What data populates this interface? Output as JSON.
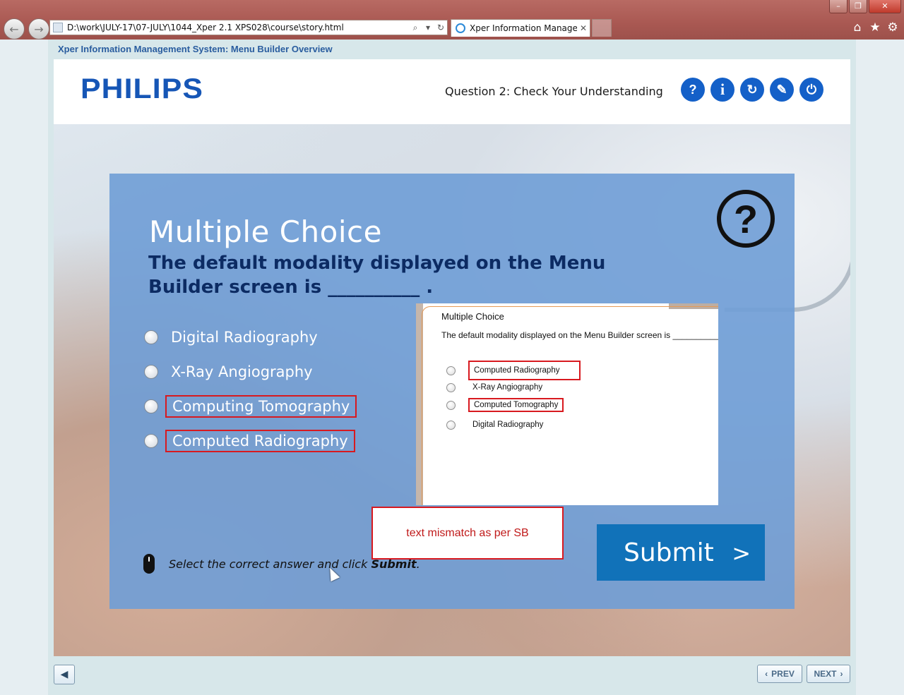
{
  "browser": {
    "address": "D:\\work\\JULY-17\\07-JULY\\1044_Xper 2.1 XPS028\\course\\story.html",
    "tab_title": "Xper Information Manage...",
    "window_controls": [
      "minimize-icon",
      "restore-icon",
      "close-icon"
    ],
    "icons": [
      "back-icon",
      "forward-icon",
      "search-icon",
      "refresh-icon",
      "close-tab-icon",
      "home-icon",
      "favorites-star-icon",
      "settings-gear-icon"
    ]
  },
  "course": {
    "title": "Xper Information Management System: Menu Builder Overview",
    "logo": "PHILIPS",
    "question_heading": "Question 2: Check Your Understanding",
    "header_buttons": [
      {
        "name": "help",
        "glyph": "?"
      },
      {
        "name": "info",
        "glyph": "i"
      },
      {
        "name": "replay",
        "glyph": "↻"
      },
      {
        "name": "resources",
        "glyph": "✎"
      },
      {
        "name": "exit",
        "glyph": "⏻"
      }
    ],
    "accent_color": "#1460c8"
  },
  "quiz": {
    "type_title": "Multiple Choice",
    "question": "The default modality displayed on the Menu Builder screen is __________ .",
    "options": [
      {
        "label": "Digital Radiography",
        "highlighted": false
      },
      {
        "label": "X-Ray Angiography",
        "highlighted": false
      },
      {
        "label": "Computing Tomography",
        "highlighted": true
      },
      {
        "label": "Computed Radiography",
        "highlighted": true
      }
    ],
    "instruction_prefix": "Select the correct answer and click ",
    "instruction_bold": "Submit",
    "instruction_suffix": ".",
    "submit_label": "Submit",
    "submit_arrow": ">"
  },
  "reference_shot": {
    "title": "Multiple Choice",
    "question": "The default modality displayed on the Menu Builder screen is ____________.",
    "options": [
      {
        "label": "Computed Radiography",
        "highlighted": true
      },
      {
        "label": "X-Ray Angiography",
        "highlighted": false
      },
      {
        "label": "Computed Tomography",
        "highlighted": true
      },
      {
        "label": "Digital Radiography",
        "highlighted": false
      }
    ]
  },
  "review_note": "text mismatch as per SB",
  "footer": {
    "prev_label": "PREV",
    "next_label": "NEXT"
  }
}
